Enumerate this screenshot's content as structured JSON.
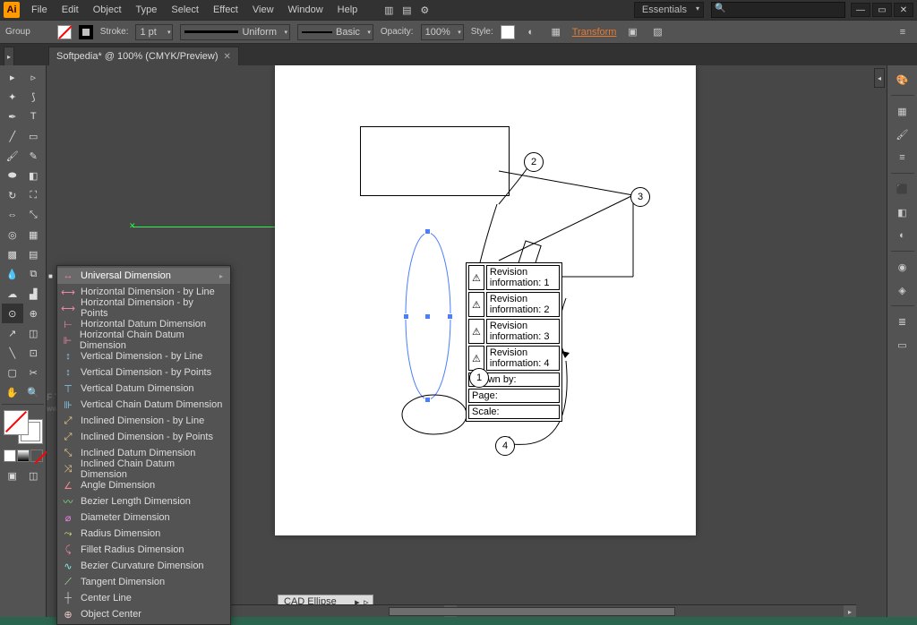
{
  "menus": [
    "File",
    "Edit",
    "Object",
    "Type",
    "Select",
    "Effect",
    "View",
    "Window",
    "Help"
  ],
  "workspace": "Essentials",
  "control": {
    "selection": "Group",
    "stroke_label": "Stroke:",
    "stroke_pt": "1 pt",
    "uniform": "Uniform",
    "basic": "Basic",
    "opacity_label": "Opacity:",
    "opacity_val": "100%",
    "style_label": "Style:",
    "transform_label": "Transform"
  },
  "tab": {
    "title": "Softpedia* @ 100% (CMYK/Preview)"
  },
  "flyout": [
    "Universal Dimension",
    "Horizontal Dimension - by Line",
    "Horizontal Dimension - by Points",
    "Horizontal Datum Dimension",
    "Horizontal Chain Datum Dimension",
    "Vertical Dimension - by Line",
    "Vertical Dimension - by Points",
    "Vertical Datum Dimension",
    "Vertical Chain Datum Dimension",
    "Inclined Dimension - by Line",
    "Inclined Dimension - by Points",
    "Inclined Datum Dimension",
    "Inclined Chain Datum Dimension",
    "Angle Dimension",
    "Bezier Length Dimension",
    "Diameter Dimension",
    "Radius Dimension",
    "Fillet Radius Dimension",
    "Bezier Curvature Dimension",
    "Tangent Dimension",
    "Center Line",
    "Object Center"
  ],
  "table": {
    "rev": [
      "Revision information: 1",
      "Revision information: 2",
      "Revision information: 3",
      "Revision information: 4"
    ],
    "drawn": "Drawn by:",
    "page": "Page:",
    "scale": "Scale:"
  },
  "clip": "CAD Ellipse",
  "circles": {
    "c1": "1",
    "c2": "2",
    "c3": "3",
    "c4": "4"
  },
  "watermark": {
    "big": "FTPE",
    "small": "www.softpedia.com"
  }
}
